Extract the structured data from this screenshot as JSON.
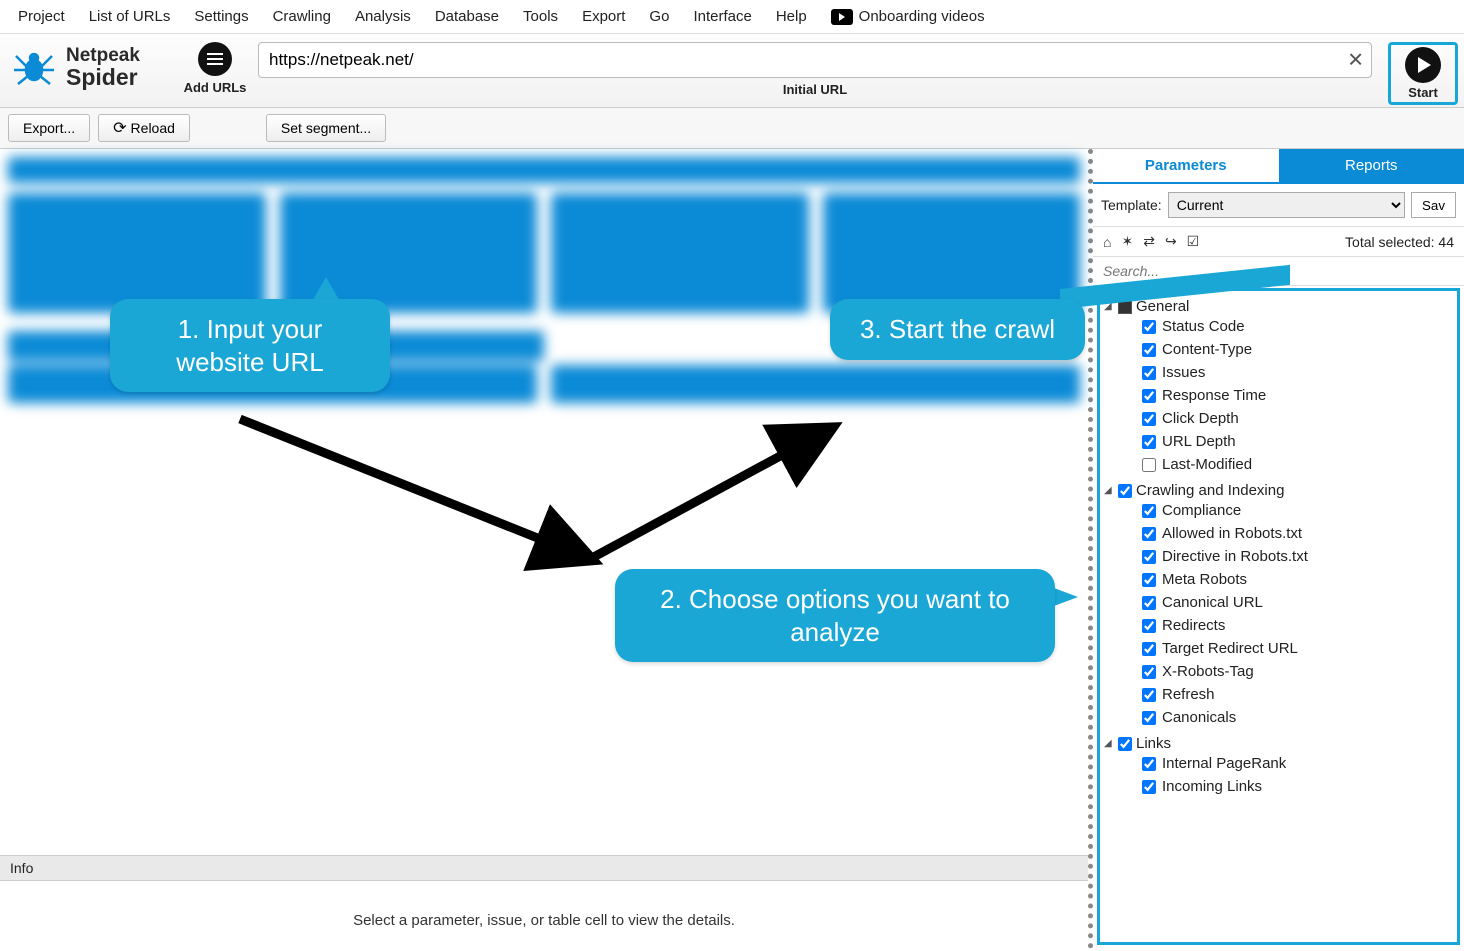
{
  "menu": [
    "Project",
    "List of URLs",
    "Settings",
    "Crawling",
    "Analysis",
    "Database",
    "Tools",
    "Export",
    "Go",
    "Interface",
    "Help"
  ],
  "menu_extra": "Onboarding videos",
  "brand": {
    "l1": "Netpeak",
    "l2": "Spider"
  },
  "add_urls_label": "Add URLs",
  "url_value": "https://netpeak.net/",
  "url_sublabel": "Initial URL",
  "start_label": "Start",
  "export_btn": "Export...",
  "reload_btn": "Reload",
  "segment_btn": "Set segment...",
  "info_label": "Info",
  "info_detail": "Select a parameter, issue, or table cell to view the details.",
  "tabs": {
    "parameters": "Parameters",
    "reports": "Reports"
  },
  "template_label": "Template:",
  "template_value": "Current",
  "save_btn": "Sav",
  "total_selected": "Total selected: 44",
  "search_placeholder": "Search...",
  "callouts": {
    "c1": "1. Input your website URL",
    "c2": "2. Choose options you want to analyze",
    "c3": "3. Start the crawl"
  },
  "tree": [
    {
      "label": "General",
      "checked": "partial",
      "children": [
        {
          "label": "Status Code",
          "checked": true
        },
        {
          "label": "Content-Type",
          "checked": true
        },
        {
          "label": "Issues",
          "checked": true
        },
        {
          "label": "Response Time",
          "checked": true
        },
        {
          "label": "Click Depth",
          "checked": true
        },
        {
          "label": "URL Depth",
          "checked": true
        },
        {
          "label": "Last-Modified",
          "checked": false
        }
      ]
    },
    {
      "label": "Crawling and Indexing",
      "checked": true,
      "children": [
        {
          "label": "Compliance",
          "checked": true
        },
        {
          "label": "Allowed in Robots.txt",
          "checked": true
        },
        {
          "label": "Directive in Robots.txt",
          "checked": true
        },
        {
          "label": "Meta Robots",
          "checked": true
        },
        {
          "label": "Canonical URL",
          "checked": true
        },
        {
          "label": "Redirects",
          "checked": true
        },
        {
          "label": "Target Redirect URL",
          "checked": true
        },
        {
          "label": "X-Robots-Tag",
          "checked": true
        },
        {
          "label": "Refresh",
          "checked": true
        },
        {
          "label": "Canonicals",
          "checked": true
        }
      ]
    },
    {
      "label": "Links",
      "checked": true,
      "children": [
        {
          "label": "Internal PageRank",
          "checked": true
        },
        {
          "label": "Incoming Links",
          "checked": true
        }
      ]
    }
  ]
}
